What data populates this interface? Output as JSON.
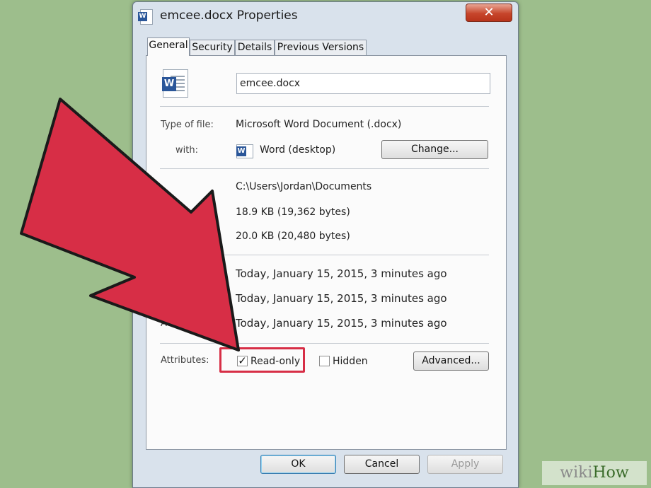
{
  "window": {
    "title": "emcee.docx Properties",
    "close_glyph": "✕"
  },
  "tabs": [
    {
      "label": "General",
      "active": true
    },
    {
      "label": "Security",
      "active": false
    },
    {
      "label": "Details",
      "active": false
    },
    {
      "label": "Previous Versions",
      "active": false
    }
  ],
  "general": {
    "file_name": "emcee.docx",
    "type_label": "Type of file:",
    "type_value": "Microsoft Word Document (.docx)",
    "opens_label": "with:",
    "opens_value": "Word (desktop)",
    "change_button": "Change...",
    "location_value": "C:\\Users\\Jordan\\Documents",
    "size_value": "18.9 KB (19,362 bytes)",
    "size_on_disk_value": "20.0 KB (20,480 bytes)",
    "created_value": "Today, January 15, 2015, 3 minutes ago",
    "modified_value": "Today, January 15, 2015, 3 minutes ago",
    "accessed_label": "Acce",
    "accessed_value": "Today, January 15, 2015, 3 minutes ago",
    "attributes_label": "Attributes:",
    "readonly_label": "Read-only",
    "readonly_checked": true,
    "hidden_label": "Hidden",
    "hidden_checked": false,
    "advanced_button": "Advanced..."
  },
  "footer": {
    "ok": "OK",
    "cancel": "Cancel",
    "apply": "Apply"
  },
  "overlay": {
    "arrow_color": "#d72e46",
    "watermark_wiki": "wiki",
    "watermark_how": "How"
  },
  "colors": {
    "background": "#9dbe8c",
    "highlight": "#d72e46"
  }
}
